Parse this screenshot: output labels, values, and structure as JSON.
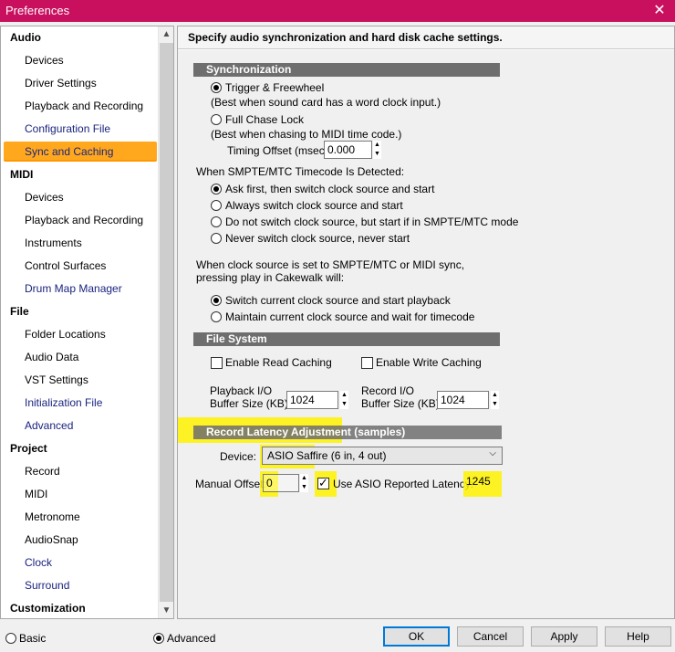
{
  "window": {
    "title": "Preferences",
    "close_glyph": "✕"
  },
  "sidebar": {
    "items": [
      {
        "label": "Audio",
        "kind": "cat"
      },
      {
        "label": "Devices",
        "kind": "sub"
      },
      {
        "label": "Driver Settings",
        "kind": "sub"
      },
      {
        "label": "Playback and Recording",
        "kind": "sub"
      },
      {
        "label": "Configuration File",
        "kind": "sub link"
      },
      {
        "label": "Sync and Caching",
        "kind": "selected"
      },
      {
        "label": "MIDI",
        "kind": "cat"
      },
      {
        "label": "Devices",
        "kind": "sub"
      },
      {
        "label": "Playback and Recording",
        "kind": "sub"
      },
      {
        "label": "Instruments",
        "kind": "sub"
      },
      {
        "label": "Control Surfaces",
        "kind": "sub"
      },
      {
        "label": "Drum Map Manager",
        "kind": "sub link"
      },
      {
        "label": "File",
        "kind": "cat"
      },
      {
        "label": "Folder Locations",
        "kind": "sub"
      },
      {
        "label": "Audio Data",
        "kind": "sub"
      },
      {
        "label": "VST Settings",
        "kind": "sub"
      },
      {
        "label": "Initialization File",
        "kind": "sub link"
      },
      {
        "label": "Advanced",
        "kind": "sub link"
      },
      {
        "label": "Project",
        "kind": "cat"
      },
      {
        "label": "Record",
        "kind": "sub"
      },
      {
        "label": "MIDI",
        "kind": "sub"
      },
      {
        "label": "Metronome",
        "kind": "sub"
      },
      {
        "label": "AudioSnap",
        "kind": "sub"
      },
      {
        "label": "Clock",
        "kind": "sub link"
      },
      {
        "label": "Surround",
        "kind": "sub link"
      },
      {
        "label": "Customization",
        "kind": "cat"
      }
    ]
  },
  "panel": {
    "header": "Specify audio synchronization and hard disk cache settings.",
    "sync": {
      "title": "Synchronization",
      "trigger_label": "Trigger & Freewheel",
      "trigger_note": "(Best when sound card has a word clock input.)",
      "chase_label": "Full Chase Lock",
      "chase_note": "(Best when chasing to MIDI time code.)",
      "timing_label": "Timing Offset (msec):",
      "timing_value": "0.000"
    },
    "smpte": {
      "heading": "When SMPTE/MTC Timecode Is Detected:",
      "options": [
        "Ask first, then switch clock source and start",
        "Always switch clock source and start",
        "Do not switch clock source, but start if in SMPTE/MTC mode",
        "Never switch clock source, never start"
      ]
    },
    "clock": {
      "heading1": "When clock source is set to SMPTE/MTC or MIDI sync,",
      "heading2": "pressing play in Cakewalk will:",
      "options": [
        "Switch current clock source and start playback",
        "Maintain current clock source and wait for timecode"
      ]
    },
    "filesystem": {
      "title": "File System",
      "read_label": "Enable Read Caching",
      "write_label": "Enable Write Caching",
      "playback_label1": "Playback I/O",
      "playback_label2": "Buffer Size (KB):",
      "playback_value": "1024",
      "record_label1": "Record I/O",
      "record_label2": "Buffer Size (KB):",
      "record_value": "1024"
    },
    "latency": {
      "title": "Record Latency Adjustment (samples)",
      "device_label": "Device:",
      "device_value": "ASIO Saffire (6 in, 4 out)",
      "offset_label": "Manual Offset:",
      "offset_value": "0",
      "asio_label": "Use ASIO Reported Latency:",
      "asio_value": "1245"
    }
  },
  "footer": {
    "basic_label": "Basic",
    "advanced_label": "Advanced",
    "ok": "OK",
    "cancel": "Cancel",
    "apply": "Apply",
    "help": "Help"
  },
  "colors": {
    "titlebar": "#c8105e",
    "selection": "#ffa81e",
    "highlighter": "#fff200",
    "ok_border": "#0078d7"
  }
}
